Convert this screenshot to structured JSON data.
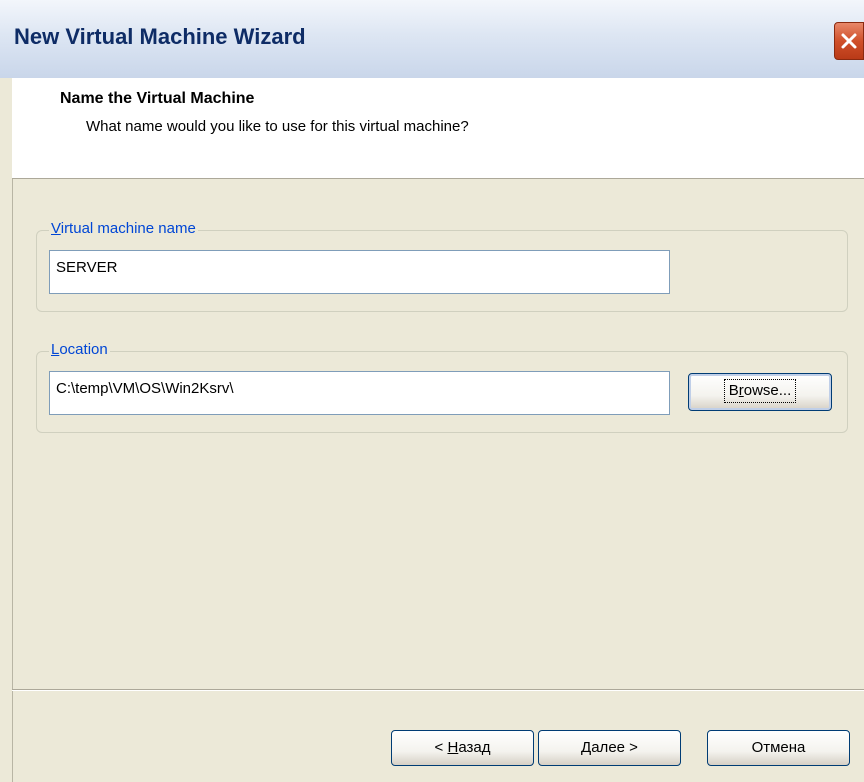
{
  "window": {
    "title": "New Virtual Machine Wizard"
  },
  "header": {
    "title": "Name the Virtual Machine",
    "subtitle": "What name would you like to use for this virtual machine?"
  },
  "vm_name_group": {
    "legend_accel": "V",
    "legend_rest": "irtual machine name",
    "value": "SERVER"
  },
  "location_group": {
    "legend_accel": "L",
    "legend_rest": "ocation",
    "value": "C:\\temp\\VM\\OS\\Win2Ksrv\\",
    "browse_pre": "B",
    "browse_accel": "r",
    "browse_post": "owse..."
  },
  "footer": {
    "back_pre": "< ",
    "back_accel": "Н",
    "back_post": "азад",
    "next_accel": "Д",
    "next_post": "алее >",
    "cancel_label": "Отмена"
  },
  "colors": {
    "title_text": "#0e2c66",
    "legend_text": "#0046d5",
    "close_button": "#d0502a",
    "dialog_bg": "#ece9d8"
  }
}
